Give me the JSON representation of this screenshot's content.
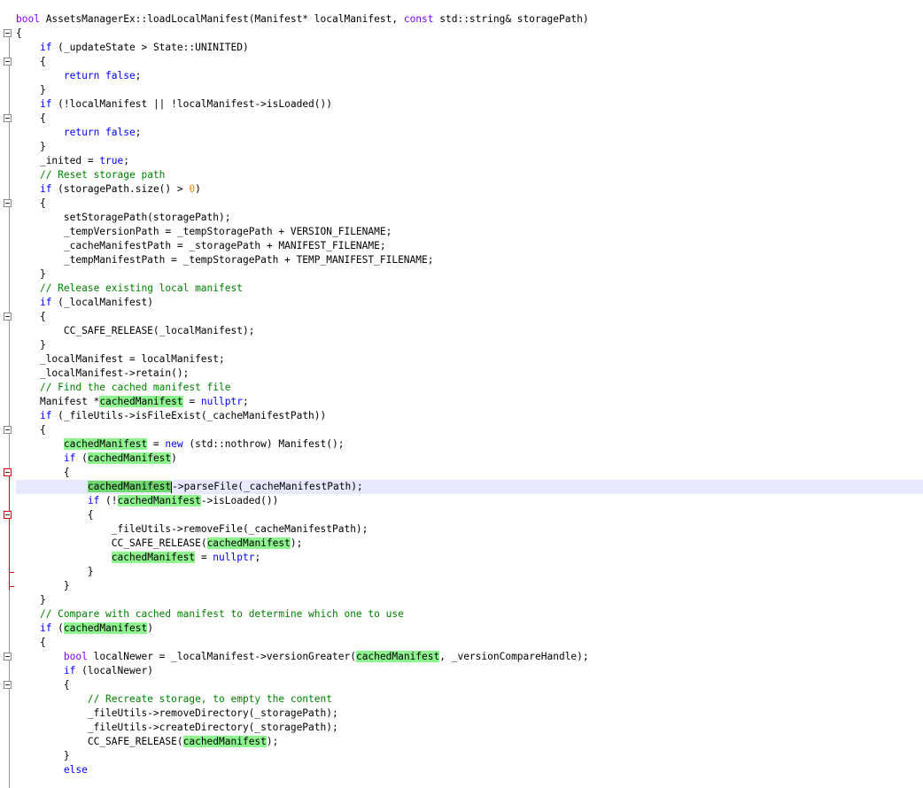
{
  "editor": {
    "current_line_index": 33,
    "lines": [
      {
        "indent": 0,
        "tokens": [
          {
            "t": "t",
            "v": "bool"
          },
          {
            "t": "p",
            "v": " AssetsManagerEx::loadLocalManifest(Manifest* localManifest, "
          },
          {
            "t": "t",
            "v": "const"
          },
          {
            "t": "p",
            "v": " std::string& storagePath)"
          }
        ]
      },
      {
        "indent": 0,
        "tokens": [
          {
            "t": "p",
            "v": "{"
          }
        ]
      },
      {
        "indent": 1,
        "tokens": [
          {
            "t": "k",
            "v": "if"
          },
          {
            "t": "p",
            "v": " (_updateState > State::UNINITED)"
          }
        ]
      },
      {
        "indent": 1,
        "tokens": [
          {
            "t": "p",
            "v": "{"
          }
        ]
      },
      {
        "indent": 2,
        "tokens": [
          {
            "t": "k",
            "v": "return false"
          },
          {
            "t": "p",
            "v": ";"
          }
        ]
      },
      {
        "indent": 1,
        "tokens": [
          {
            "t": "p",
            "v": "}"
          }
        ]
      },
      {
        "indent": 1,
        "tokens": [
          {
            "t": "k",
            "v": "if"
          },
          {
            "t": "p",
            "v": " (!localManifest || !localManifest->isLoaded())"
          }
        ]
      },
      {
        "indent": 1,
        "tokens": [
          {
            "t": "p",
            "v": "{"
          }
        ]
      },
      {
        "indent": 2,
        "tokens": [
          {
            "t": "k",
            "v": "return false"
          },
          {
            "t": "p",
            "v": ";"
          }
        ]
      },
      {
        "indent": 1,
        "tokens": [
          {
            "t": "p",
            "v": "}"
          }
        ]
      },
      {
        "indent": 1,
        "tokens": [
          {
            "t": "p",
            "v": "_inited = "
          },
          {
            "t": "k",
            "v": "true"
          },
          {
            "t": "p",
            "v": ";"
          }
        ]
      },
      {
        "indent": 1,
        "tokens": [
          {
            "t": "c",
            "v": "// Reset storage path"
          }
        ]
      },
      {
        "indent": 1,
        "tokens": [
          {
            "t": "k",
            "v": "if"
          },
          {
            "t": "p",
            "v": " (storagePath.size() > "
          },
          {
            "t": "n",
            "v": "0"
          },
          {
            "t": "p",
            "v": ")"
          }
        ]
      },
      {
        "indent": 1,
        "tokens": [
          {
            "t": "p",
            "v": "{"
          }
        ]
      },
      {
        "indent": 2,
        "tokens": [
          {
            "t": "p",
            "v": "setStoragePath(storagePath);"
          }
        ]
      },
      {
        "indent": 2,
        "tokens": [
          {
            "t": "p",
            "v": "_tempVersionPath = _tempStoragePath + VERSION_FILENAME;"
          }
        ]
      },
      {
        "indent": 2,
        "tokens": [
          {
            "t": "p",
            "v": "_cacheManifestPath = _storagePath + MANIFEST_FILENAME;"
          }
        ]
      },
      {
        "indent": 2,
        "tokens": [
          {
            "t": "p",
            "v": "_tempManifestPath = _tempStoragePath + TEMP_MANIFEST_FILENAME;"
          }
        ]
      },
      {
        "indent": 1,
        "tokens": [
          {
            "t": "p",
            "v": "}"
          }
        ]
      },
      {
        "indent": 1,
        "tokens": [
          {
            "t": "c",
            "v": "// Release existing local manifest"
          }
        ]
      },
      {
        "indent": 1,
        "tokens": [
          {
            "t": "k",
            "v": "if"
          },
          {
            "t": "p",
            "v": " (_localManifest)"
          }
        ]
      },
      {
        "indent": 1,
        "tokens": [
          {
            "t": "p",
            "v": "{"
          }
        ]
      },
      {
        "indent": 2,
        "tokens": [
          {
            "t": "p",
            "v": "CC_SAFE_RELEASE(_localManifest);"
          }
        ]
      },
      {
        "indent": 1,
        "tokens": [
          {
            "t": "p",
            "v": "}"
          }
        ]
      },
      {
        "indent": 1,
        "tokens": [
          {
            "t": "p",
            "v": "_localManifest = localManifest;"
          }
        ]
      },
      {
        "indent": 1,
        "tokens": [
          {
            "t": "p",
            "v": "_localManifest->retain();"
          }
        ]
      },
      {
        "indent": 1,
        "tokens": [
          {
            "t": "c",
            "v": "// Find the cached manifest file"
          }
        ]
      },
      {
        "indent": 1,
        "tokens": [
          {
            "t": "p",
            "v": "Manifest *"
          },
          {
            "t": "h",
            "v": "cachedManifest"
          },
          {
            "t": "p",
            "v": " = "
          },
          {
            "t": "k",
            "v": "nullptr"
          },
          {
            "t": "p",
            "v": ";"
          }
        ]
      },
      {
        "indent": 1,
        "tokens": [
          {
            "t": "k",
            "v": "if"
          },
          {
            "t": "p",
            "v": " (_fileUtils->isFileExist(_cacheManifestPath))"
          }
        ]
      },
      {
        "indent": 1,
        "tokens": [
          {
            "t": "p",
            "v": "{"
          }
        ]
      },
      {
        "indent": 2,
        "tokens": [
          {
            "t": "h",
            "v": "cachedManifest"
          },
          {
            "t": "p",
            "v": " = "
          },
          {
            "t": "k",
            "v": "new"
          },
          {
            "t": "p",
            "v": " (std::nothrow) Manifest();"
          }
        ]
      },
      {
        "indent": 2,
        "tokens": [
          {
            "t": "k",
            "v": "if"
          },
          {
            "t": "p",
            "v": " ("
          },
          {
            "t": "h",
            "v": "cachedManifest"
          },
          {
            "t": "p",
            "v": ")"
          }
        ]
      },
      {
        "indent": 2,
        "tokens": [
          {
            "t": "p",
            "v": "{"
          }
        ]
      },
      {
        "indent": 3,
        "tokens": [
          {
            "t": "H",
            "v": "cachedManifest"
          },
          {
            "t": "caret",
            "v": ""
          },
          {
            "t": "p",
            "v": "->parseFile(_cacheManifestPath);"
          }
        ]
      },
      {
        "indent": 3,
        "tokens": [
          {
            "t": "k",
            "v": "if"
          },
          {
            "t": "p",
            "v": " (!"
          },
          {
            "t": "h",
            "v": "cachedManifest"
          },
          {
            "t": "p",
            "v": "->isLoaded())"
          }
        ]
      },
      {
        "indent": 3,
        "tokens": [
          {
            "t": "p",
            "v": "{"
          }
        ]
      },
      {
        "indent": 4,
        "tokens": [
          {
            "t": "p",
            "v": "_fileUtils->removeFile(_cacheManifestPath);"
          }
        ]
      },
      {
        "indent": 4,
        "tokens": [
          {
            "t": "p",
            "v": "CC_SAFE_RELEASE("
          },
          {
            "t": "h",
            "v": "cachedManifest"
          },
          {
            "t": "p",
            "v": ");"
          }
        ]
      },
      {
        "indent": 4,
        "tokens": [
          {
            "t": "h",
            "v": "cachedManifest"
          },
          {
            "t": "p",
            "v": " = "
          },
          {
            "t": "k",
            "v": "nullptr"
          },
          {
            "t": "p",
            "v": ";"
          }
        ]
      },
      {
        "indent": 3,
        "tokens": [
          {
            "t": "p",
            "v": "}"
          }
        ]
      },
      {
        "indent": 2,
        "tokens": [
          {
            "t": "p",
            "v": "}"
          }
        ]
      },
      {
        "indent": 1,
        "tokens": [
          {
            "t": "p",
            "v": "}"
          }
        ]
      },
      {
        "indent": 1,
        "tokens": [
          {
            "t": "c",
            "v": "// Compare with cached manifest to determine which one to use"
          }
        ]
      },
      {
        "indent": 1,
        "tokens": [
          {
            "t": "k",
            "v": "if"
          },
          {
            "t": "p",
            "v": " ("
          },
          {
            "t": "h",
            "v": "cachedManifest"
          },
          {
            "t": "p",
            "v": ")"
          }
        ]
      },
      {
        "indent": 1,
        "tokens": [
          {
            "t": "p",
            "v": "{"
          }
        ]
      },
      {
        "indent": 2,
        "tokens": [
          {
            "t": "t",
            "v": "bool"
          },
          {
            "t": "p",
            "v": " localNewer = _localManifest->versionGreater("
          },
          {
            "t": "h",
            "v": "cachedManifest"
          },
          {
            "t": "p",
            "v": ", _versionCompareHandle);"
          }
        ]
      },
      {
        "indent": 2,
        "tokens": [
          {
            "t": "k",
            "v": "if"
          },
          {
            "t": "p",
            "v": " (localNewer)"
          }
        ]
      },
      {
        "indent": 2,
        "tokens": [
          {
            "t": "p",
            "v": "{"
          }
        ]
      },
      {
        "indent": 3,
        "tokens": [
          {
            "t": "c",
            "v": "// Recreate storage, to empty the content"
          }
        ]
      },
      {
        "indent": 3,
        "tokens": [
          {
            "t": "p",
            "v": "_fileUtils->removeDirectory(_storagePath);"
          }
        ]
      },
      {
        "indent": 3,
        "tokens": [
          {
            "t": "p",
            "v": "_fileUtils->createDirectory(_storagePath);"
          }
        ]
      },
      {
        "indent": 3,
        "tokens": [
          {
            "t": "p",
            "v": "CC_SAFE_RELEASE("
          },
          {
            "t": "h",
            "v": "cachedManifest"
          },
          {
            "t": "p",
            "v": ");"
          }
        ]
      },
      {
        "indent": 2,
        "tokens": [
          {
            "t": "p",
            "v": "}"
          }
        ]
      },
      {
        "indent": 2,
        "tokens": [
          {
            "t": "k",
            "v": "else"
          }
        ]
      }
    ]
  },
  "colors": {
    "keyword": "#0000ff",
    "type": "#8000ff",
    "comment": "#008000",
    "number": "#ff8000",
    "highlight": "#8ef58e",
    "current_line": "#e8e8ff",
    "fold_red": "#d40000"
  },
  "icons": [
    "fold-collapse-icon"
  ]
}
